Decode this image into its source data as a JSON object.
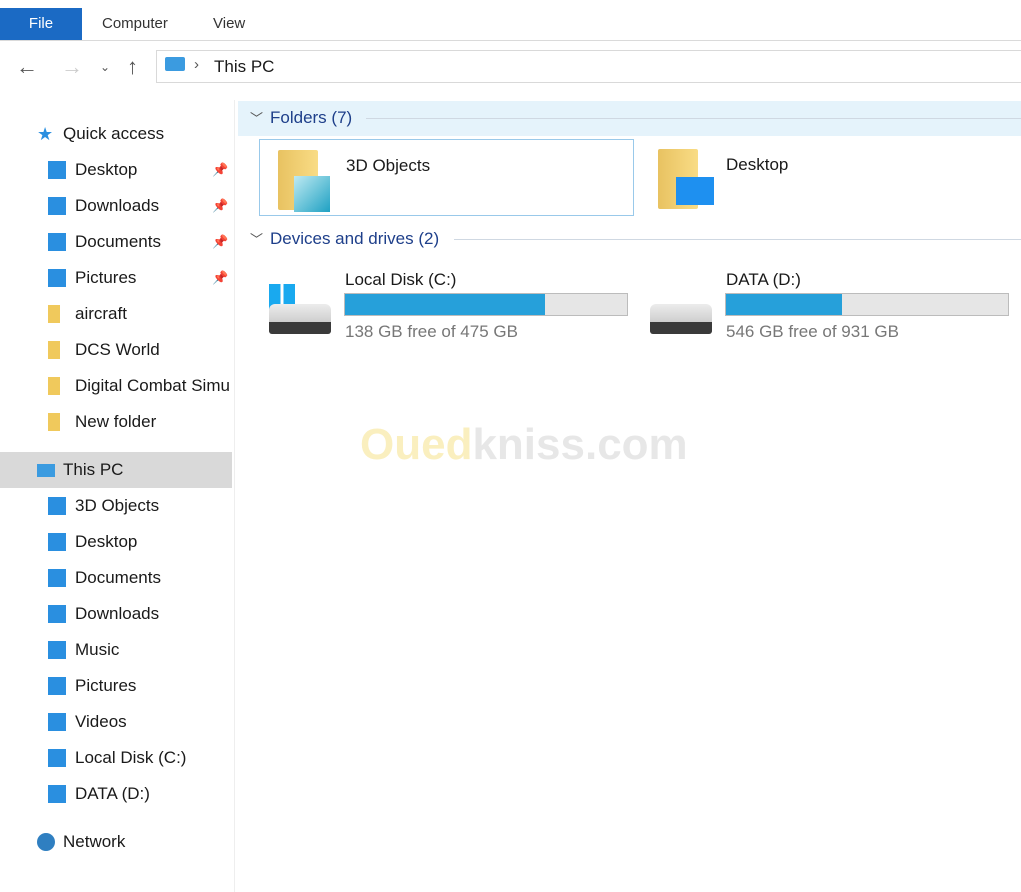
{
  "ribbon": {
    "tabs": [
      "File",
      "Computer",
      "View"
    ]
  },
  "address": {
    "path": "This PC"
  },
  "sidebar": {
    "quick_access": "Quick access",
    "quick_items": [
      {
        "label": "Desktop",
        "pinned": true,
        "icon": "desktop-icon"
      },
      {
        "label": "Downloads",
        "pinned": true,
        "icon": "download-icon"
      },
      {
        "label": "Documents",
        "pinned": true,
        "icon": "document-icon"
      },
      {
        "label": "Pictures",
        "pinned": true,
        "icon": "pictures-icon"
      },
      {
        "label": "aircraft",
        "icon": "folder-icon"
      },
      {
        "label": "DCS World",
        "icon": "folder-icon"
      },
      {
        "label": "Digital Combat Simu",
        "icon": "folder-icon"
      },
      {
        "label": "New folder",
        "icon": "folder-icon"
      }
    ],
    "this_pc": "This PC",
    "pc_items": [
      {
        "label": "3D Objects"
      },
      {
        "label": "Desktop"
      },
      {
        "label": "Documents"
      },
      {
        "label": "Downloads"
      },
      {
        "label": "Music"
      },
      {
        "label": "Pictures"
      },
      {
        "label": "Videos"
      },
      {
        "label": "Local Disk (C:)"
      },
      {
        "label": "DATA (D:)"
      }
    ],
    "network": "Network"
  },
  "main": {
    "folders_header": "Folders (7)",
    "folders": [
      {
        "name": "3D Objects"
      },
      {
        "name": "Desktop"
      }
    ],
    "devices_header": "Devices and drives (2)",
    "drives": [
      {
        "name": "Local Disk (C:)",
        "free": "138 GB free of 475 GB",
        "used_fraction": 0.71
      },
      {
        "name": "DATA (D:)",
        "free": "546 GB free of 931 GB",
        "used_fraction": 0.41
      }
    ]
  },
  "watermark": {
    "part1": "Oued",
    "part2": "kniss.com"
  },
  "colors": {
    "accent": "#1b6ac4",
    "bar": "#26a0da"
  }
}
